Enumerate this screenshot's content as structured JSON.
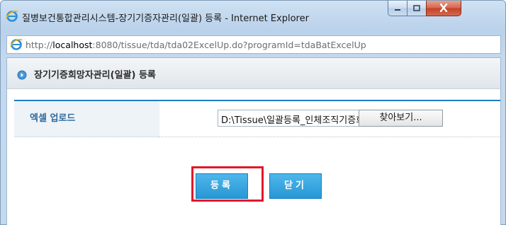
{
  "window": {
    "title": "질병보건통합관리시스템-장기기증자관리(일괄) 등록 - Internet Explorer",
    "controls": {
      "minimize": "minimize-icon",
      "maximize": "maximize-icon",
      "close": "close-icon"
    }
  },
  "address_bar": {
    "url_prefix": "http://",
    "url_host": "localhost",
    "url_rest": ":8080/tissue/tda/tda02ExcelUp.do?programId=tdaBatExcelUp"
  },
  "page": {
    "header_title": "장기기증희망자관리(일괄) 등록",
    "form": {
      "excel_upload_label": "엑셀 업로드",
      "file_path_value": "D:\\Tissue\\일괄등록_인체조직기증희망자.xlsx",
      "browse_label": "찾아보기..."
    },
    "buttons": {
      "register_label": "등록",
      "close_label": "닫기"
    }
  },
  "colors": {
    "accent_blue": "#2897d6",
    "highlight_red": "#e0182a",
    "label_blue": "#2d6a9f",
    "table_top_border": "#1d7ec6"
  }
}
